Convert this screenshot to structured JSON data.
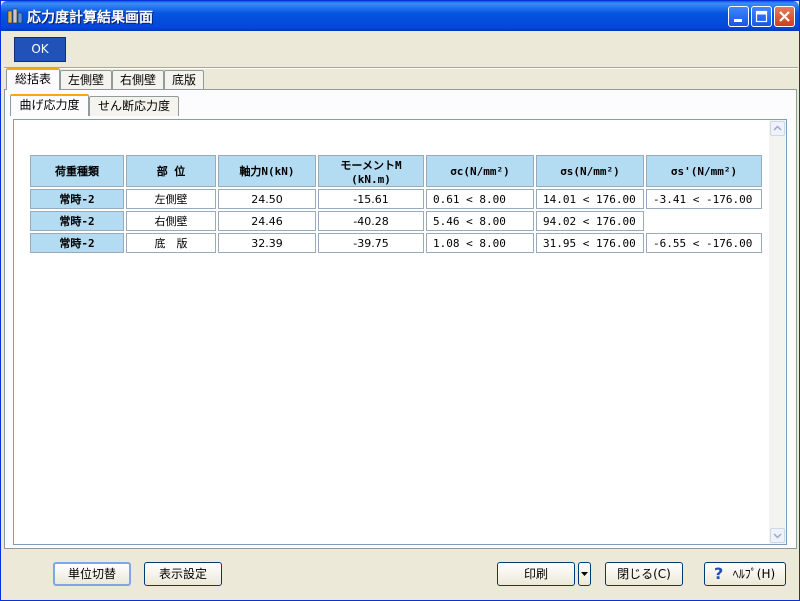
{
  "window": {
    "title": "応力度計算結果画面"
  },
  "toolbar": {
    "ok_label": "OK"
  },
  "outer_tabs": [
    "総括表",
    "左側壁",
    "右側壁",
    "底版"
  ],
  "inner_tabs": [
    "曲げ応力度",
    "せん断応力度"
  ],
  "table": {
    "headers": {
      "load": "荷重種類",
      "part": "部 位",
      "axial": "軸力N(kN)",
      "moment_line1": "モーメントM",
      "moment_line2": "(kN.m)",
      "sc": "σc(N/mm²)",
      "ss": "σs(N/mm²)",
      "ss2": "σs'(N/mm²)"
    },
    "rows": [
      {
        "load": "常時-2",
        "part": "左側壁",
        "axial": "24.50",
        "moment": "-15.61",
        "sc": "0.61 < 8.00",
        "ss": "14.01 < 176.00",
        "ss2": "-3.41 < -176.00"
      },
      {
        "load": "常時-2",
        "part": "右側壁",
        "axial": "24.46",
        "moment": "-40.28",
        "sc": "5.46 < 8.00",
        "ss": "94.02 < 176.00",
        "ss2": ""
      },
      {
        "load": "常時-2",
        "part": "底　版",
        "axial": "32.39",
        "moment": "-39.75",
        "sc": "1.08 < 8.00",
        "ss": "31.95 < 176.00",
        "ss2": "-6.55 < -176.00"
      }
    ]
  },
  "footer": {
    "unit_switch": "単位切替",
    "display_settings": "表示設定",
    "print": "印刷",
    "close": "閉じる(C)",
    "help": "ﾍﾙﾌﾟ(H)"
  },
  "colors": {
    "titlebar": "#0555e3",
    "header_cell": "#b3dcf2",
    "ok_button": "#2152b8",
    "active_tab_accent": "#f6a90f"
  }
}
